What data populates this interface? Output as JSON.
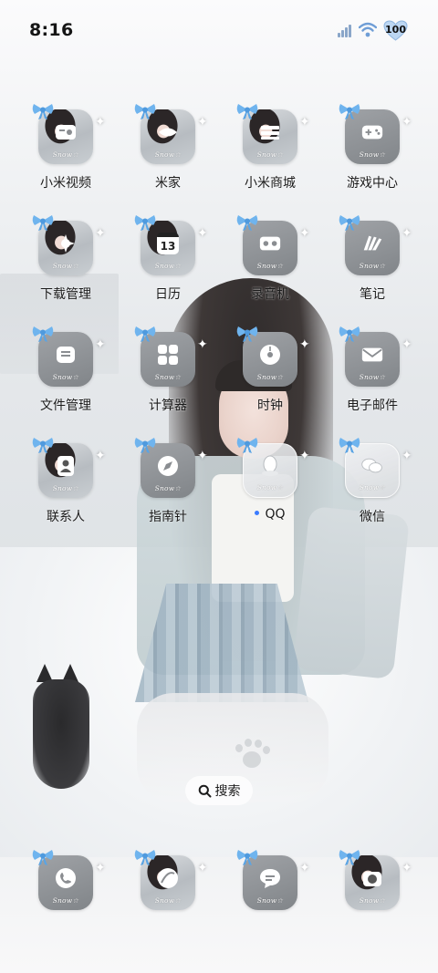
{
  "status_bar": {
    "time": "8:16",
    "battery": "100",
    "icons": [
      "signal-icon",
      "wifi-icon",
      "battery-icon"
    ]
  },
  "icon_tag": "Snow☆",
  "apps": [
    {
      "label": "小米视频",
      "icon": "video-icon",
      "style": "photo"
    },
    {
      "label": "米家",
      "icon": "mijia-icon",
      "style": "photo"
    },
    {
      "label": "小米商城",
      "icon": "store-icon",
      "style": "photo"
    },
    {
      "label": "游戏中心",
      "icon": "gamepad-icon",
      "style": "gray"
    },
    {
      "label": "下载管理",
      "icon": "download-icon",
      "style": "photo"
    },
    {
      "label": "日历",
      "icon": "calendar-icon",
      "style": "photo",
      "badge": "13"
    },
    {
      "label": "录音机",
      "icon": "recorder-icon",
      "style": "gray"
    },
    {
      "label": "笔记",
      "icon": "notes-icon",
      "style": "gray"
    },
    {
      "label": "文件管理",
      "icon": "files-icon",
      "style": "gray"
    },
    {
      "label": "计算器",
      "icon": "calculator-icon",
      "style": "gray"
    },
    {
      "label": "时钟",
      "icon": "clock-icon",
      "style": "gray"
    },
    {
      "label": "电子邮件",
      "icon": "mail-icon",
      "style": "gray"
    },
    {
      "label": "联系人",
      "icon": "contacts-icon",
      "style": "photo"
    },
    {
      "label": "指南针",
      "icon": "compass-icon",
      "style": "gray"
    },
    {
      "label": "QQ",
      "icon": "qq-icon",
      "style": "frost",
      "new_dot": true
    },
    {
      "label": "微信",
      "icon": "wechat-icon",
      "style": "frost"
    }
  ],
  "search": {
    "label": "搜索"
  },
  "dock": [
    {
      "name": "phone",
      "icon": "phone-icon",
      "style": "gray"
    },
    {
      "name": "browser",
      "icon": "browser-icon",
      "style": "photo"
    },
    {
      "name": "messages",
      "icon": "messages-icon",
      "style": "gray"
    },
    {
      "name": "camera",
      "icon": "camera-icon",
      "style": "photo"
    }
  ],
  "colors": {
    "accent_dot": "#3a7bff",
    "bow": "#6fb4ee"
  }
}
